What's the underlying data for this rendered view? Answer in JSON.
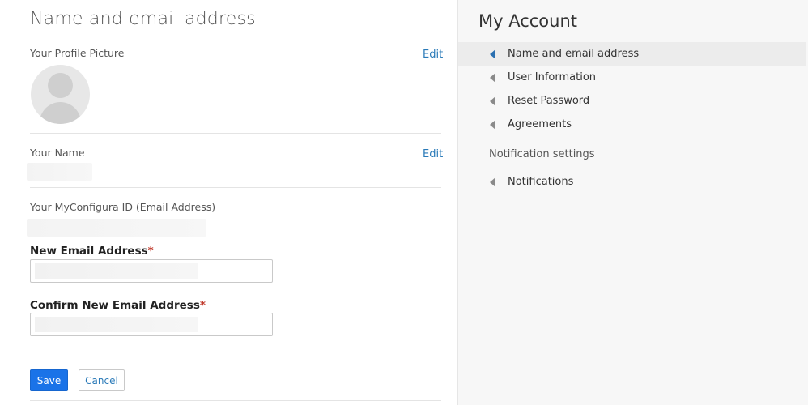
{
  "main": {
    "title": "Name and email address",
    "profile_picture": {
      "label": "Your Profile Picture",
      "edit": "Edit"
    },
    "name": {
      "label": "Your Name",
      "edit": "Edit"
    },
    "id": {
      "label": "Your MyConfigura ID (Email Address)"
    },
    "new_email": {
      "label": "New Email Address",
      "required_mark": "*",
      "value": "",
      "placeholder": ""
    },
    "confirm_email": {
      "label": "Confirm New Email Address",
      "required_mark": "*",
      "value": "",
      "placeholder": ""
    },
    "save_label": "Save",
    "cancel_label": "Cancel"
  },
  "sidebar": {
    "title": "My Account",
    "items": [
      {
        "label": "Name and email address",
        "active": true
      },
      {
        "label": "User Information",
        "active": false
      },
      {
        "label": "Reset Password",
        "active": false
      },
      {
        "label": "Agreements",
        "active": false
      }
    ],
    "notification_heading": "Notification settings",
    "notification_items": [
      {
        "label": "Notifications",
        "active": false
      }
    ]
  },
  "colors": {
    "accent": "#1a73e8",
    "link": "#2a7ab8",
    "required": "#c0392b",
    "active_indicator": "#2a6fb0"
  },
  "icons": {
    "avatar": "user-placeholder-icon",
    "nav_arrow": "triangle-left-icon"
  }
}
